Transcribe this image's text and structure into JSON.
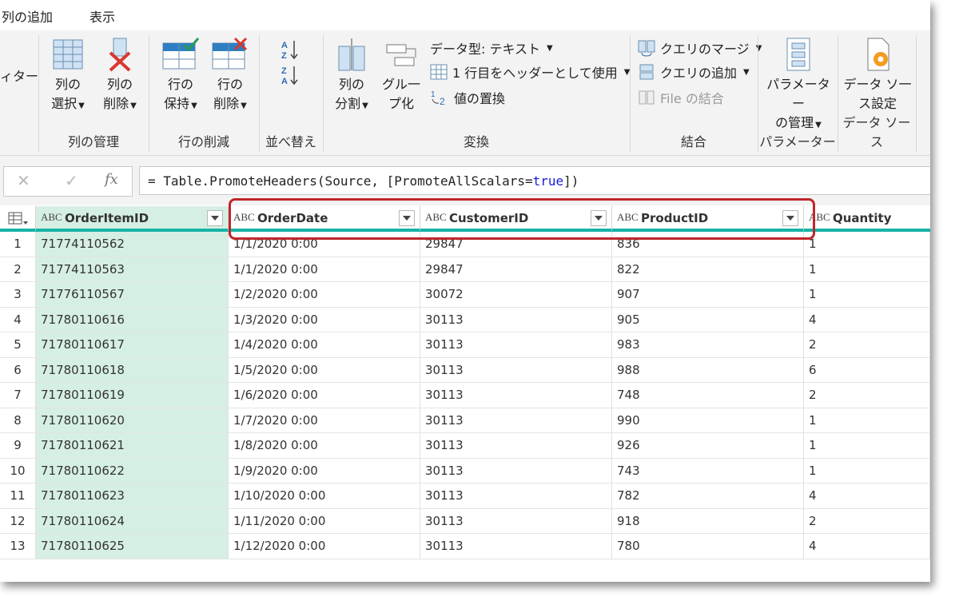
{
  "menu": {
    "tabs": [
      "列の追加",
      "表示"
    ]
  },
  "ribbon": {
    "edge_label": "ィター",
    "groups": {
      "column_mgmt": {
        "label": "列の管理",
        "choose": [
          "列の",
          "選択"
        ],
        "remove": [
          "列の",
          "削除"
        ]
      },
      "row_reduce": {
        "label": "行の削減",
        "keep": [
          "行の",
          "保持"
        ],
        "remove": [
          "行の",
          "削除"
        ]
      },
      "sort": {
        "label": "並べ替え"
      },
      "transform": {
        "label": "変換",
        "split": [
          "列の",
          "分割"
        ],
        "group": [
          "グル一",
          "プ化"
        ],
        "data_type": "データ型: テキスト",
        "use_first_row": "1 行目をヘッダーとして使用",
        "replace_values": "値の置換"
      },
      "combine": {
        "label": "結合",
        "merge": "クエリのマージ",
        "append": "クエリの追加",
        "file_combine": "File の結合"
      },
      "params": {
        "label": "パラメーター",
        "manage": [
          "パラメーター",
          "の管理"
        ]
      },
      "datasource": {
        "label": "データ ソース",
        "settings": [
          "データ ソ一",
          "ス設定"
        ]
      }
    }
  },
  "formula": {
    "prefix": "= Table.PromoteHeaders(Source, [PromoteAllScalars=",
    "keyword": "true",
    "suffix": "])"
  },
  "table": {
    "type_icon": "ABC",
    "columns": [
      "OrderItemID",
      "OrderDate",
      "CustomerID",
      "ProductID",
      "Quantity"
    ],
    "rows": [
      [
        "1",
        "71774110562",
        "1/1/2020 0:00",
        "29847",
        "836",
        "1"
      ],
      [
        "2",
        "71774110563",
        "1/1/2020 0:00",
        "29847",
        "822",
        "1"
      ],
      [
        "3",
        "71776110567",
        "1/2/2020 0:00",
        "30072",
        "907",
        "1"
      ],
      [
        "4",
        "71780110616",
        "1/3/2020 0:00",
        "30113",
        "905",
        "4"
      ],
      [
        "5",
        "71780110617",
        "1/4/2020 0:00",
        "30113",
        "983",
        "2"
      ],
      [
        "6",
        "71780110618",
        "1/5/2020 0:00",
        "30113",
        "988",
        "6"
      ],
      [
        "7",
        "71780110619",
        "1/6/2020 0:00",
        "30113",
        "748",
        "2"
      ],
      [
        "8",
        "71780110620",
        "1/7/2020 0:00",
        "30113",
        "990",
        "1"
      ],
      [
        "9",
        "71780110621",
        "1/8/2020 0:00",
        "30113",
        "926",
        "1"
      ],
      [
        "10",
        "71780110622",
        "1/9/2020 0:00",
        "30113",
        "743",
        "1"
      ],
      [
        "11",
        "71780110623",
        "1/10/2020 0:00",
        "30113",
        "782",
        "4"
      ],
      [
        "12",
        "71780110624",
        "1/11/2020 0:00",
        "30113",
        "918",
        "2"
      ],
      [
        "13",
        "71780110625",
        "1/12/2020 0:00",
        "30113",
        "780",
        "4"
      ]
    ]
  },
  "colors": {
    "accent": "#17b3a5",
    "selected_col": "#d6efe3",
    "highlight": "#c0262c"
  }
}
